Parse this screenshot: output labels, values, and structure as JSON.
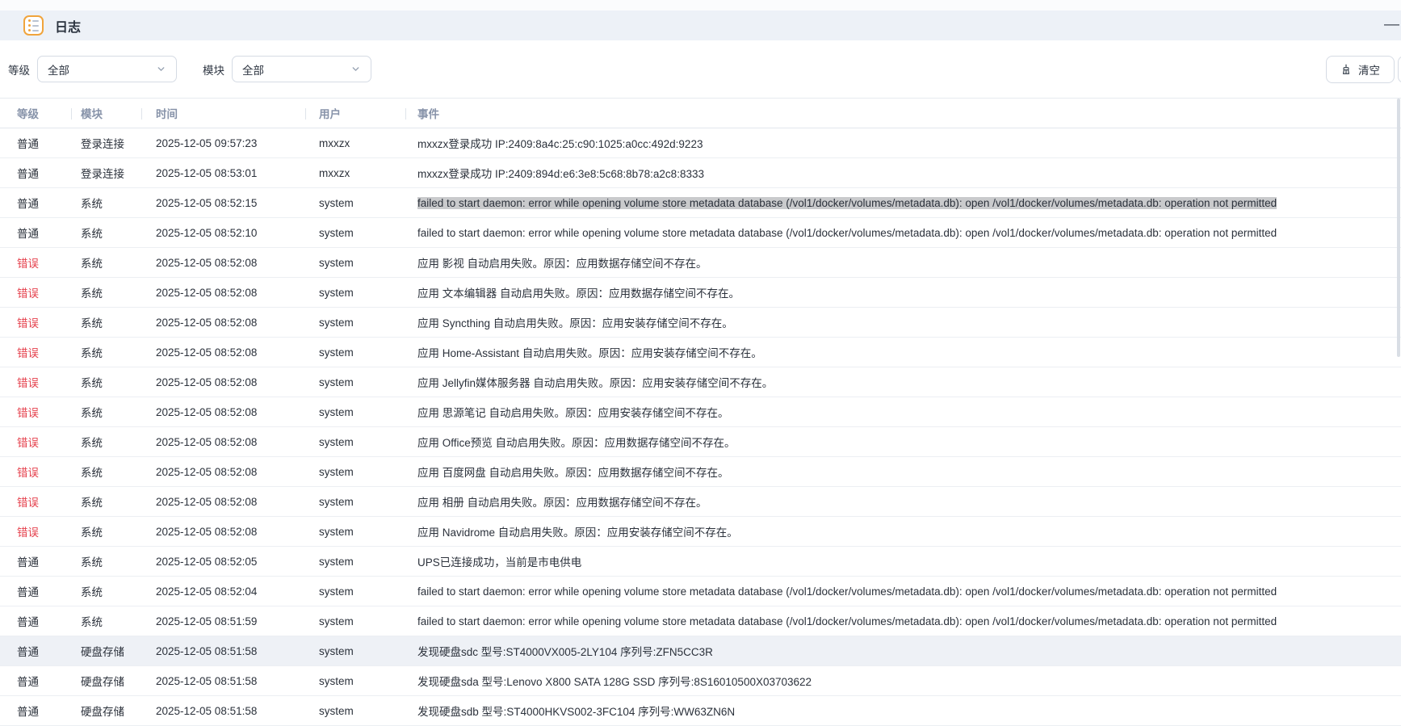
{
  "window": {
    "title": "日志",
    "minimize_label": "—"
  },
  "filters": {
    "level": {
      "label": "等级",
      "value": "全部"
    },
    "module": {
      "label": "模块",
      "value": "全部"
    }
  },
  "toolbar": {
    "clear_label": "清空"
  },
  "table": {
    "columns": [
      {
        "label": "等级"
      },
      {
        "label": "模块"
      },
      {
        "label": "时间"
      },
      {
        "label": "用户"
      },
      {
        "label": "事件"
      }
    ],
    "rows": [
      {
        "level": "普通",
        "level_style": "normal",
        "module": "登录连接",
        "time": "2025-12-05 09:57:23",
        "user": "mxxzx",
        "event": "mxxzx登录成功 IP:2409:8a4c:25:c90:1025:a0cc:492d:9223"
      },
      {
        "level": "普通",
        "level_style": "normal",
        "module": "登录连接",
        "time": "2025-12-05 08:53:01",
        "user": "mxxzx",
        "event": "mxxzx登录成功 IP:2409:894d:e6:3e8:5c68:8b78:a2c8:8333"
      },
      {
        "level": "普通",
        "level_style": "normal",
        "module": "系统",
        "time": "2025-12-05 08:52:15",
        "user": "system",
        "event": "failed to start daemon: error while opening volume store metadata database (/vol1/docker/volumes/metadata.db): open /vol1/docker/volumes/metadata.db: operation not permitted",
        "text_selected": true
      },
      {
        "level": "普通",
        "level_style": "normal",
        "module": "系统",
        "time": "2025-12-05 08:52:10",
        "user": "system",
        "event": "failed to start daemon: error while opening volume store metadata database (/vol1/docker/volumes/metadata.db): open /vol1/docker/volumes/metadata.db: operation not permitted"
      },
      {
        "level": "错误",
        "level_style": "error",
        "module": "系统",
        "time": "2025-12-05 08:52:08",
        "user": "system",
        "event": "应用 影视 自动启用失败。原因：应用数据存储空间不存在。"
      },
      {
        "level": "错误",
        "level_style": "error",
        "module": "系统",
        "time": "2025-12-05 08:52:08",
        "user": "system",
        "event": "应用 文本编辑器 自动启用失败。原因：应用数据存储空间不存在。"
      },
      {
        "level": "错误",
        "level_style": "error",
        "module": "系统",
        "time": "2025-12-05 08:52:08",
        "user": "system",
        "event": "应用 Syncthing 自动启用失败。原因：应用安装存储空间不存在。"
      },
      {
        "level": "错误",
        "level_style": "error",
        "module": "系统",
        "time": "2025-12-05 08:52:08",
        "user": "system",
        "event": "应用 Home-Assistant 自动启用失败。原因：应用安装存储空间不存在。"
      },
      {
        "level": "错误",
        "level_style": "error",
        "module": "系统",
        "time": "2025-12-05 08:52:08",
        "user": "system",
        "event": "应用 Jellyfin媒体服务器 自动启用失败。原因：应用安装存储空间不存在。"
      },
      {
        "level": "错误",
        "level_style": "error",
        "module": "系统",
        "time": "2025-12-05 08:52:08",
        "user": "system",
        "event": "应用 思源笔记 自动启用失败。原因：应用安装存储空间不存在。"
      },
      {
        "level": "错误",
        "level_style": "error",
        "module": "系统",
        "time": "2025-12-05 08:52:08",
        "user": "system",
        "event": "应用 Office预览 自动启用失败。原因：应用数据存储空间不存在。"
      },
      {
        "level": "错误",
        "level_style": "error",
        "module": "系统",
        "time": "2025-12-05 08:52:08",
        "user": "system",
        "event": "应用 百度网盘 自动启用失败。原因：应用数据存储空间不存在。"
      },
      {
        "level": "错误",
        "level_style": "error",
        "module": "系统",
        "time": "2025-12-05 08:52:08",
        "user": "system",
        "event": "应用 相册 自动启用失败。原因：应用数据存储空间不存在。"
      },
      {
        "level": "错误",
        "level_style": "error",
        "module": "系统",
        "time": "2025-12-05 08:52:08",
        "user": "system",
        "event": "应用 Navidrome 自动启用失败。原因：应用安装存储空间不存在。"
      },
      {
        "level": "普通",
        "level_style": "normal",
        "module": "系统",
        "time": "2025-12-05 08:52:05",
        "user": "system",
        "event": "UPS已连接成功，当前是市电供电"
      },
      {
        "level": "普通",
        "level_style": "normal",
        "module": "系统",
        "time": "2025-12-05 08:52:04",
        "user": "system",
        "event": "failed to start daemon: error while opening volume store metadata database (/vol1/docker/volumes/metadata.db): open /vol1/docker/volumes/metadata.db: operation not permitted"
      },
      {
        "level": "普通",
        "level_style": "normal",
        "module": "系统",
        "time": "2025-12-05 08:51:59",
        "user": "system",
        "event": "failed to start daemon: error while opening volume store metadata database (/vol1/docker/volumes/metadata.db): open /vol1/docker/volumes/metadata.db: operation not permitted"
      },
      {
        "level": "普通",
        "level_style": "normal",
        "module": "硬盘存储",
        "time": "2025-12-05 08:51:58",
        "user": "system",
        "event": "发现硬盘sdc 型号:ST4000VX005-2LY104 序列号:ZFN5CC3R",
        "row_highlighted": true
      },
      {
        "level": "普通",
        "level_style": "normal",
        "module": "硬盘存储",
        "time": "2025-12-05 08:51:58",
        "user": "system",
        "event": "发现硬盘sda 型号:Lenovo X800 SATA 128G SSD 序列号:8S16010500X03703622"
      },
      {
        "level": "普通",
        "level_style": "normal",
        "module": "硬盘存储",
        "time": "2025-12-05 08:51:58",
        "user": "system",
        "event": "发现硬盘sdb 型号:ST4000HKVS002-3FC104 序列号:WW63ZN6N"
      }
    ]
  },
  "colors": {
    "error_text": "#e5424e",
    "app_icon_accent": "#f0a43c",
    "titlebar_bg": "#edf1f7",
    "row_highlight_bg": "#eef1f6",
    "text_selection_bg": "#c9cacc"
  }
}
